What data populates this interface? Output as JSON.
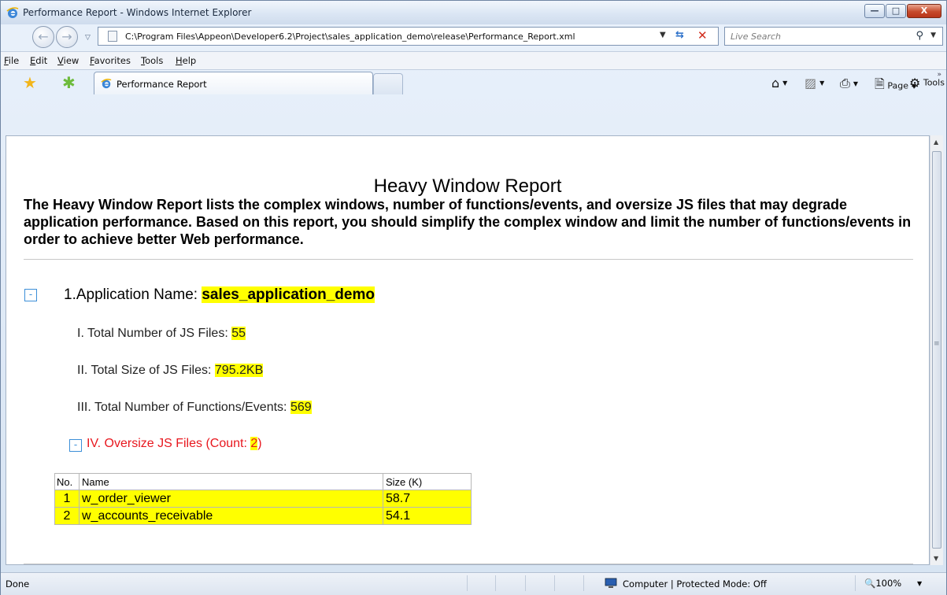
{
  "window": {
    "title": "Performance Report - Windows Internet Explorer",
    "controls": {
      "minimize": "—",
      "maximize": "□",
      "close": "X"
    }
  },
  "address_bar": {
    "url": "C:\\Program Files\\Appeon\\Developer6.2\\Project\\sales_application_demo\\release\\Performance_Report.xml",
    "search_placeholder": "Live Search"
  },
  "menu": [
    "File",
    "Edit",
    "View",
    "Favorites",
    "Tools",
    "Help"
  ],
  "tab": {
    "title": "Performance Report"
  },
  "command_bar": {
    "page_label": "Page",
    "tools_label": "Tools"
  },
  "report": {
    "title": "Heavy Window Report",
    "intro": "The Heavy Window Report lists the complex windows, number of functions/events, and oversize JS files that may degrade application performance. Based on this report, you should simplify the complex window and limit the number of functions/events in order to achieve better Web performance.",
    "collapse_symbol": "-",
    "app_prefix": "1.Application Name: ",
    "app_name": "sales_application_demo",
    "stats": [
      {
        "label": "I. Total Number of JS Files: ",
        "value": "55"
      },
      {
        "label": "II. Total Size of JS Files: ",
        "value": "795.2KB"
      },
      {
        "label": "III. Total Number of Functions/Events: ",
        "value": "569"
      }
    ],
    "oversize": {
      "prefix": "IV. Oversize JS Files (Count: ",
      "count": "2",
      "suffix": ")"
    },
    "table": {
      "headers": [
        "No.",
        "Name",
        "Size (K)"
      ],
      "rows": [
        [
          "1",
          "w_order_viewer",
          "58.7"
        ],
        [
          "2",
          "w_accounts_receivable",
          "54.1"
        ]
      ]
    }
  },
  "status_bar": {
    "status": "Done",
    "zone": "Computer | Protected Mode: Off",
    "zoom": "100%"
  }
}
